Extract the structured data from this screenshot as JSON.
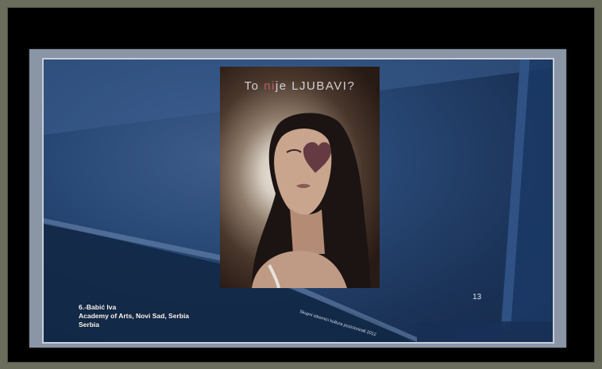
{
  "poster": {
    "title_before": "To ",
    "title_accent": "ni",
    "title_after": "je LJUBAVI?"
  },
  "caption": {
    "line1": "6.-Babić Iva",
    "line2": "Academy of Arts, Novi Sad, Serbia",
    "line3": "Serbia"
  },
  "slide_number": "13",
  "diagonal_text": "Skupni izbornici kultura pozicionirali 2012",
  "colors": {
    "slide_bg": "#1b3358",
    "title_accent": "#b65c63"
  }
}
